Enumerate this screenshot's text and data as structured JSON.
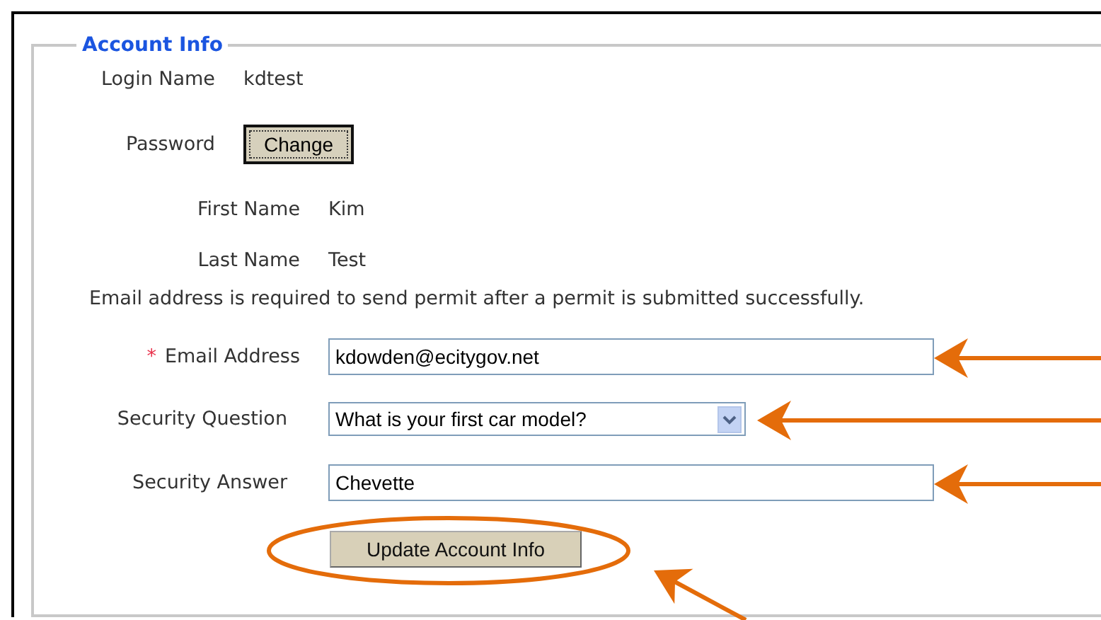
{
  "section": {
    "title": "Account Info"
  },
  "info_rows": [
    {
      "kind": "text",
      "label": "Login Name",
      "value": "kdtest"
    },
    {
      "kind": "button",
      "label": "Password",
      "button": "Change",
      "focused": true
    },
    {
      "kind": "text",
      "label": "First Name",
      "value": "Kim"
    },
    {
      "kind": "text",
      "label": "Last Name",
      "value": "Test"
    }
  ],
  "note": "Email address is required to send permit after a permit is submitted successfully.",
  "fields": [
    {
      "kind": "text",
      "label": "Email Address",
      "required_mark": "*",
      "value": "kdowden@ecitygov.net"
    },
    {
      "kind": "select",
      "label": "Security Question",
      "value": "What is your first car model?"
    },
    {
      "kind": "text",
      "label": "Security Answer",
      "value": "Chevette"
    }
  ],
  "submit_button": "Update Account Info"
}
